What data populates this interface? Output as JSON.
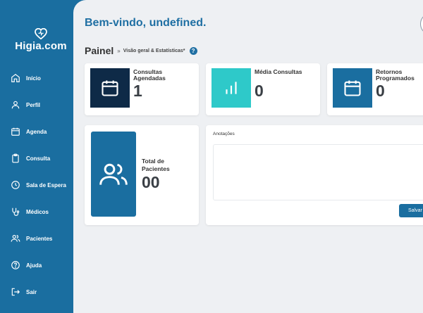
{
  "app": {
    "name": "Higia.com",
    "welcome": "Bem-vindo, undefined."
  },
  "sidebar": {
    "items": [
      {
        "label": "Início",
        "icon": "home-icon"
      },
      {
        "label": "Perfil",
        "icon": "user-icon"
      },
      {
        "label": "Agenda",
        "icon": "calendar-icon"
      },
      {
        "label": "Consulta",
        "icon": "clipboard-icon"
      },
      {
        "label": "Sala de Espera",
        "icon": "clock-icon"
      },
      {
        "label": "Médicos",
        "icon": "stethoscope-icon"
      },
      {
        "label": "Pacientes",
        "icon": "users-icon"
      },
      {
        "label": "Ajuda",
        "icon": "help-icon"
      },
      {
        "label": "Sair",
        "icon": "logout-icon"
      }
    ]
  },
  "breadcrumb": {
    "title": "Painel",
    "separator": "»",
    "subtitle": "Visão geral & Estatísticas*",
    "help": "?"
  },
  "stats": [
    {
      "label": "Consultas Agendadas",
      "value": "1",
      "icon": "calendar-icon",
      "color": "#0e2a47"
    },
    {
      "label": "Média Consultas",
      "value": "0",
      "icon": "bar-chart-icon",
      "color": "#2ec9c9"
    },
    {
      "label": "Retornos Programados",
      "value": "0",
      "icon": "calendar-icon",
      "color": "#1a6ea0"
    }
  ],
  "patients": {
    "label": "Total de Pacientes",
    "value": "00",
    "icon": "users-icon"
  },
  "notes": {
    "label": "Anotações",
    "value": "",
    "save_label": "Salvar"
  },
  "colors": {
    "sidebar": "#1a6ea0",
    "background": "#eef0f3",
    "dark_navy": "#0e2a47",
    "teal": "#2ec9c9",
    "title_blue": "#1f6fa3"
  }
}
